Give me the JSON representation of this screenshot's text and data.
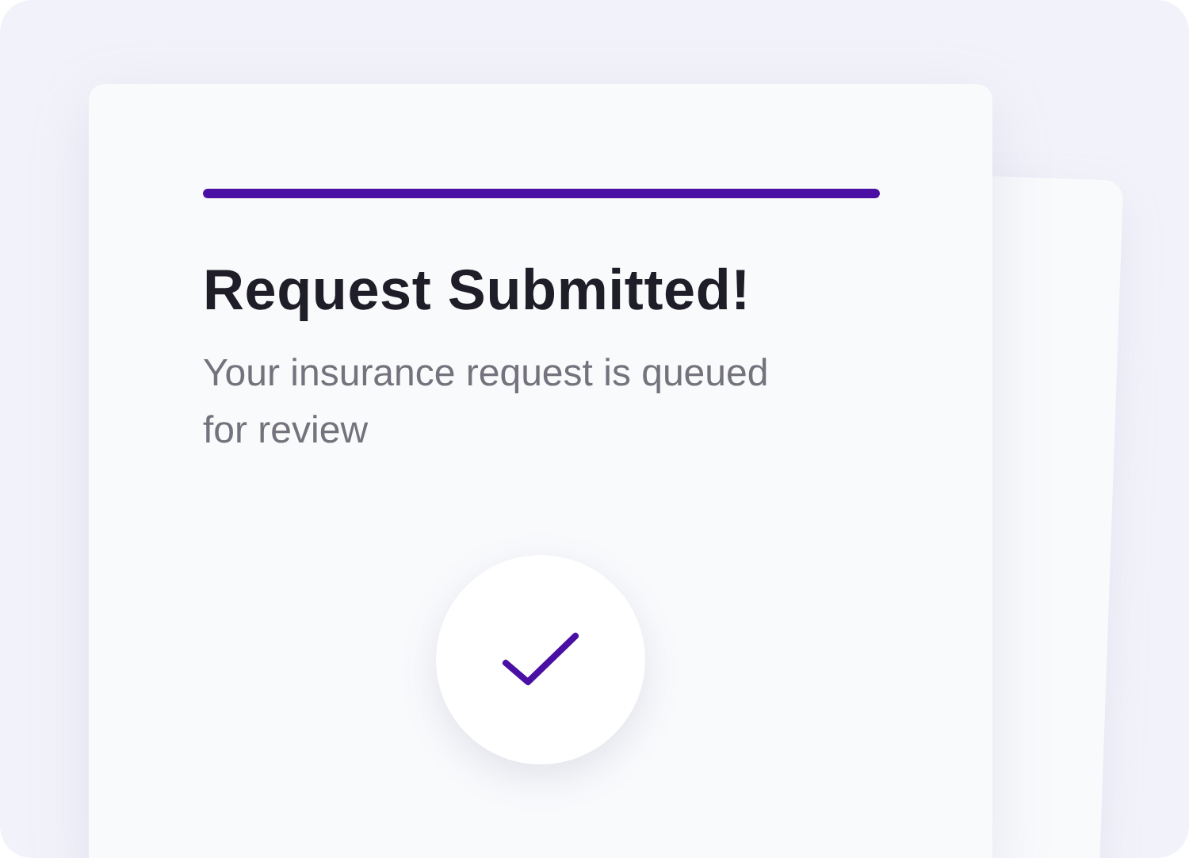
{
  "title": "Request Submitted!",
  "subtitle": "Your insurance request is queued for review",
  "status": {
    "kind": "success"
  }
}
